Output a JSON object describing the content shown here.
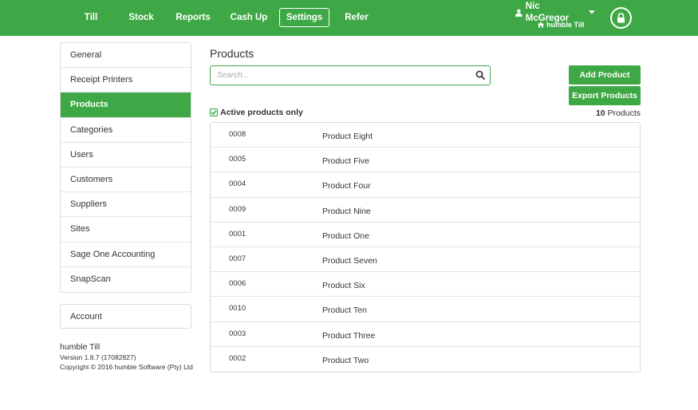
{
  "nav": {
    "items": [
      {
        "label": "Till"
      },
      {
        "label": "Stock"
      },
      {
        "label": "Reports"
      },
      {
        "label": "Cash Up"
      },
      {
        "label": "Settings"
      },
      {
        "label": "Refer"
      }
    ],
    "active": "Settings",
    "user_name": "Nic McGregor",
    "store_name": "humble Till",
    "icons": {
      "user": "user-icon",
      "dropdown": "caret-down-icon",
      "store": "home-icon",
      "lock": "lock-icon"
    }
  },
  "sidebar": {
    "items": [
      {
        "label": "General"
      },
      {
        "label": "Receipt Printers"
      },
      {
        "label": "Products"
      },
      {
        "label": "Categories"
      },
      {
        "label": "Users"
      },
      {
        "label": "Customers"
      },
      {
        "label": "Suppliers"
      },
      {
        "label": "Sites"
      },
      {
        "label": "Sage One Accounting"
      },
      {
        "label": "SnapScan"
      }
    ],
    "active": "Products",
    "account_label": "Account"
  },
  "about": {
    "app_name": "humble Till",
    "version": "Version 1.8.7 (17082827)",
    "copyright": "Copyright © 2016 humble Software (Pty) Ltd"
  },
  "main": {
    "title": "Products",
    "search": {
      "placeholder": "Search...",
      "value": ""
    },
    "add_button": "Add Product",
    "export_button": "Export Products",
    "filter_label": "Active products only",
    "filter_checked": true,
    "count_number": "10",
    "count_label": " Products",
    "products": [
      {
        "code": "0008",
        "name": "Product Eight"
      },
      {
        "code": "0005",
        "name": "Product Five"
      },
      {
        "code": "0004",
        "name": "Product Four"
      },
      {
        "code": "0009",
        "name": "Product Nine"
      },
      {
        "code": "0001",
        "name": "Product One"
      },
      {
        "code": "0007",
        "name": "Product Seven"
      },
      {
        "code": "0006",
        "name": "Product Six"
      },
      {
        "code": "0010",
        "name": "Product Ten"
      },
      {
        "code": "0003",
        "name": "Product Three"
      },
      {
        "code": "0002",
        "name": "Product Two"
      }
    ]
  },
  "colors": {
    "brand_green": "#3fa846",
    "border": "#dcdcdc",
    "text": "#333333"
  }
}
